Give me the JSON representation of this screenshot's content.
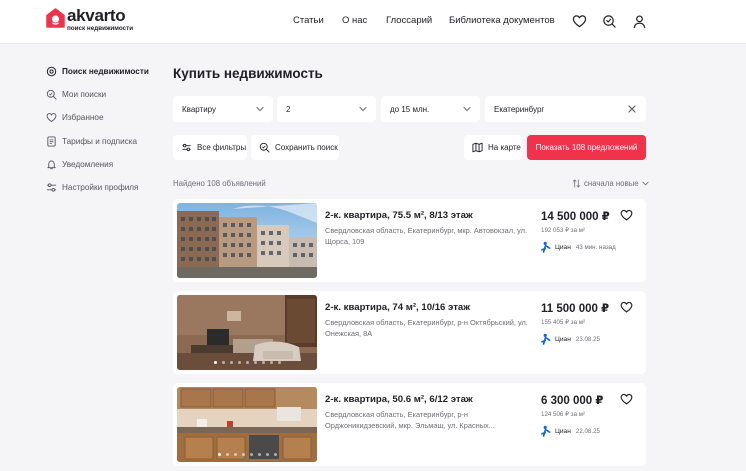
{
  "brand": {
    "name": "akvarto",
    "tagline": "поиск недвижимости",
    "accent": "#f0334b"
  },
  "header": {
    "nav": [
      "Статьи",
      "О нас",
      "Глоссарий",
      "Библиотека документов"
    ],
    "icons": [
      "heart-icon",
      "saved-search-icon",
      "user-icon"
    ]
  },
  "sidebar": {
    "items": [
      {
        "label": "Поиск недвижимости",
        "icon": "search-icon",
        "active": true
      },
      {
        "label": "Мои поиски",
        "icon": "saved-search-icon",
        "active": false
      },
      {
        "label": "Избранное",
        "icon": "heart-icon",
        "active": false
      },
      {
        "label": "Тарифы и подписка",
        "icon": "document-icon",
        "active": false
      },
      {
        "label": "Уведомления",
        "icon": "bell-icon",
        "active": false
      },
      {
        "label": "Настройки профиля",
        "icon": "settings-sliders-icon",
        "active": false
      }
    ]
  },
  "main": {
    "title": "Купить недвижимость",
    "filters": {
      "property_type": "Квартиру",
      "rooms": "2",
      "price": "до 15 млн.",
      "city": "Екатеринбург"
    },
    "buttons": {
      "all_filters": "Все фильтры",
      "save_search": "Сохранить поиск",
      "on_map": "На карте",
      "show_offers": "Показать 108 предложений"
    },
    "found_text": "Найдено 108 объявлений",
    "sort_label": "сначала новые"
  },
  "listings": [
    {
      "title": "2-к. квартира, 75.5 м², 8/13 этаж",
      "address": "Свердловская область, Екатеринбург, мкр. Автовокзал, ул. Щорса, 109",
      "price": "14 500 000 ₽",
      "price_per_m2": "192 053 ₽ за м²",
      "source": "Циан",
      "time": "43 мин. назад",
      "photo": "building-exterior"
    },
    {
      "title": "2-к. квартира, 74 м², 10/16 этаж",
      "address": "Свердловская область, Екатеринбург, р-н Октябрьский, ул. Онежская, 8А",
      "price": "11 500 000 ₽",
      "price_per_m2": "155 405 ₽ за м²",
      "source": "Циан",
      "time": "23.08.25",
      "photo": "living-room"
    },
    {
      "title": "2-к. квартира, 50.6 м², 6/12 этаж",
      "address": "Свердловская область, Екатеринбург, р-н Орджоникидзевский, мкр. Эльмаш, ул. Красных...",
      "price": "6 300 000 ₽",
      "price_per_m2": "124 506 ₽ за м²",
      "source": "Циан",
      "time": "22.08.25",
      "photo": "kitchen"
    }
  ]
}
